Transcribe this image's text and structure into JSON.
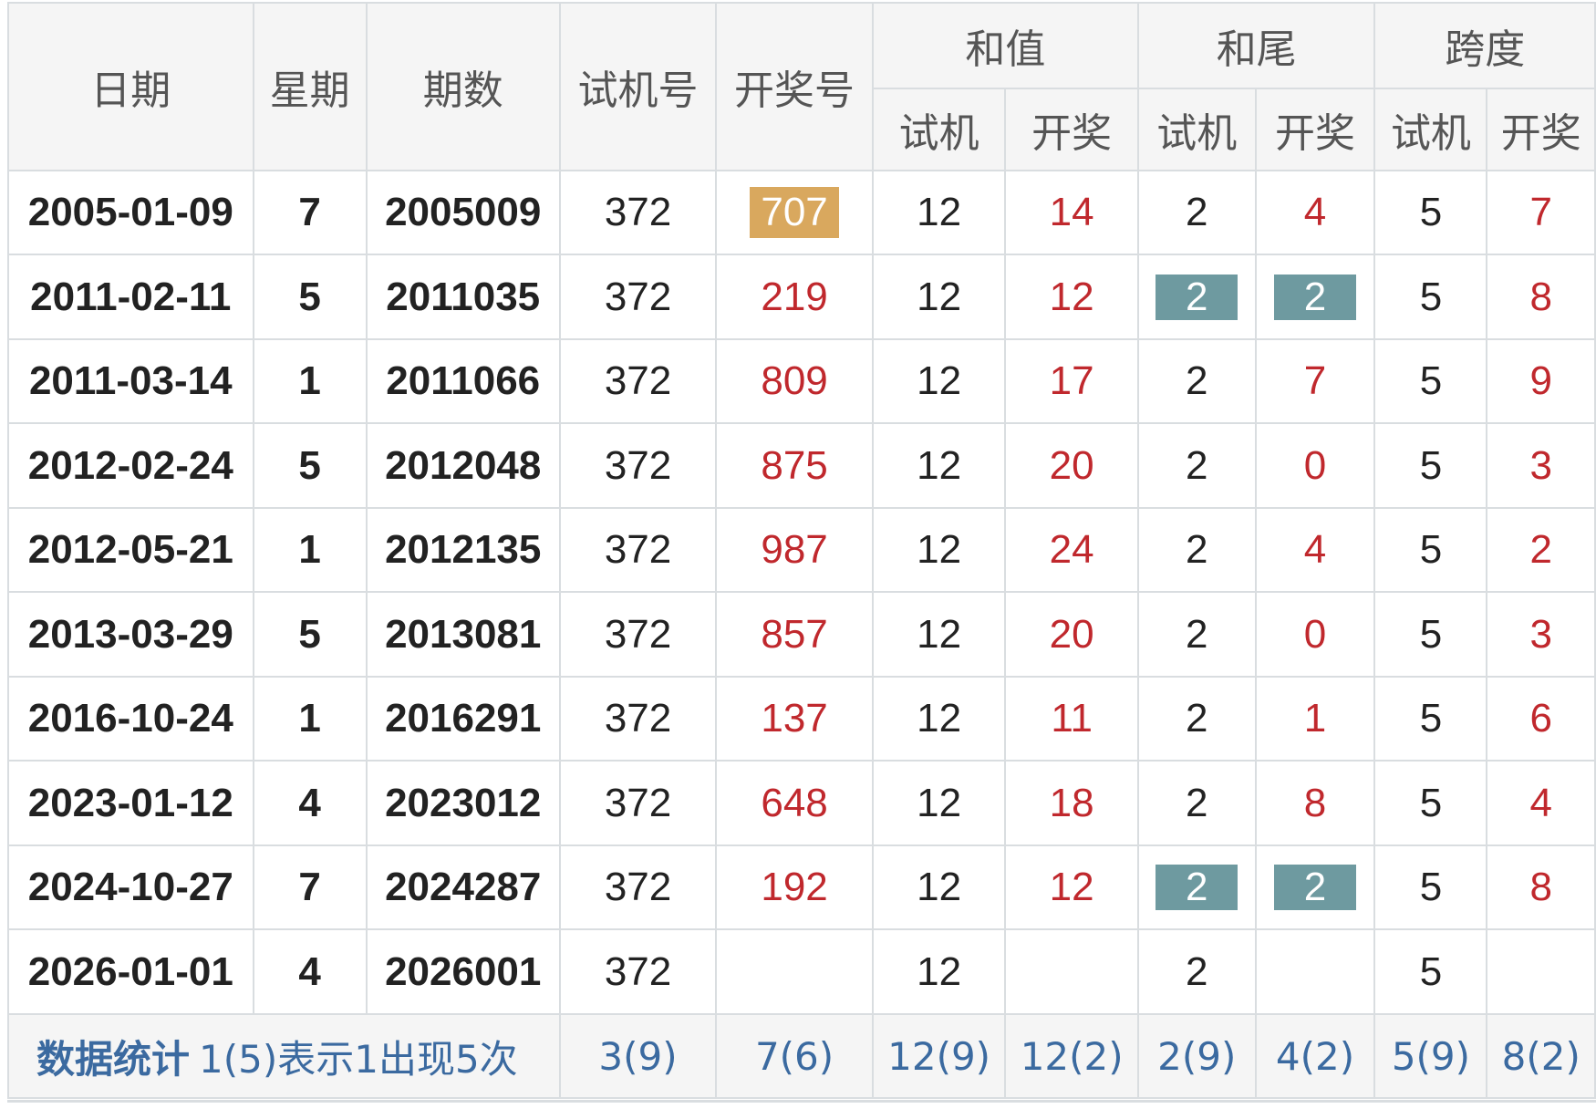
{
  "headers": {
    "date": "日期",
    "week": "星期",
    "issue": "期数",
    "trial": "试机号",
    "draw": "开奖号",
    "sum": "和值",
    "tail": "和尾",
    "span": "跨度",
    "sub_trial": "试机",
    "sub_draw": "开奖"
  },
  "rows": [
    {
      "date": "2005-01-09",
      "week": "7",
      "issue": "2005009",
      "trial": "372",
      "draw": "707",
      "sum_trial": "12",
      "sum_draw": "14",
      "tail_trial": "2",
      "tail_draw": "4",
      "span_trial": "5",
      "span_draw": "7"
    },
    {
      "date": "2011-02-11",
      "week": "5",
      "issue": "2011035",
      "trial": "372",
      "draw": "219",
      "sum_trial": "12",
      "sum_draw": "12",
      "tail_trial": "2",
      "tail_draw": "2",
      "span_trial": "5",
      "span_draw": "8"
    },
    {
      "date": "2011-03-14",
      "week": "1",
      "issue": "2011066",
      "trial": "372",
      "draw": "809",
      "sum_trial": "12",
      "sum_draw": "17",
      "tail_trial": "2",
      "tail_draw": "7",
      "span_trial": "5",
      "span_draw": "9"
    },
    {
      "date": "2012-02-24",
      "week": "5",
      "issue": "2012048",
      "trial": "372",
      "draw": "875",
      "sum_trial": "12",
      "sum_draw": "20",
      "tail_trial": "2",
      "tail_draw": "0",
      "span_trial": "5",
      "span_draw": "3"
    },
    {
      "date": "2012-05-21",
      "week": "1",
      "issue": "2012135",
      "trial": "372",
      "draw": "987",
      "sum_trial": "12",
      "sum_draw": "24",
      "tail_trial": "2",
      "tail_draw": "4",
      "span_trial": "5",
      "span_draw": "2"
    },
    {
      "date": "2013-03-29",
      "week": "5",
      "issue": "2013081",
      "trial": "372",
      "draw": "857",
      "sum_trial": "12",
      "sum_draw": "20",
      "tail_trial": "2",
      "tail_draw": "0",
      "span_trial": "5",
      "span_draw": "3"
    },
    {
      "date": "2016-10-24",
      "week": "1",
      "issue": "2016291",
      "trial": "372",
      "draw": "137",
      "sum_trial": "12",
      "sum_draw": "11",
      "tail_trial": "2",
      "tail_draw": "1",
      "span_trial": "5",
      "span_draw": "6"
    },
    {
      "date": "2023-01-12",
      "week": "4",
      "issue": "2023012",
      "trial": "372",
      "draw": "648",
      "sum_trial": "12",
      "sum_draw": "18",
      "tail_trial": "2",
      "tail_draw": "8",
      "span_trial": "5",
      "span_draw": "4"
    },
    {
      "date": "2024-10-27",
      "week": "7",
      "issue": "2024287",
      "trial": "372",
      "draw": "192",
      "sum_trial": "12",
      "sum_draw": "12",
      "tail_trial": "2",
      "tail_draw": "2",
      "span_trial": "5",
      "span_draw": "8"
    },
    {
      "date": "2026-01-01",
      "week": "4",
      "issue": "2026001",
      "trial": "372",
      "draw": "",
      "sum_trial": "12",
      "sum_draw": "",
      "tail_trial": "2",
      "tail_draw": "",
      "span_trial": "5",
      "span_draw": ""
    }
  ],
  "stats": {
    "title": "数据统计",
    "note": "1(5)表示1出现5次",
    "trial": "3(9)",
    "draw": "7(6)",
    "sum_trial": "12(9)",
    "sum_draw": "12(2)",
    "tail_trial": "2(9)",
    "tail_draw": "4(2)",
    "span_trial": "5(9)",
    "span_draw": "8(2)"
  },
  "colors": {
    "draw_text": "#c0282d",
    "gold_highlight": "#d9a85e",
    "teal_highlight": "#6e9aa0",
    "stats_text": "#3b6aa0",
    "header_bg": "#f5f5f5",
    "border": "#d9dde0"
  }
}
